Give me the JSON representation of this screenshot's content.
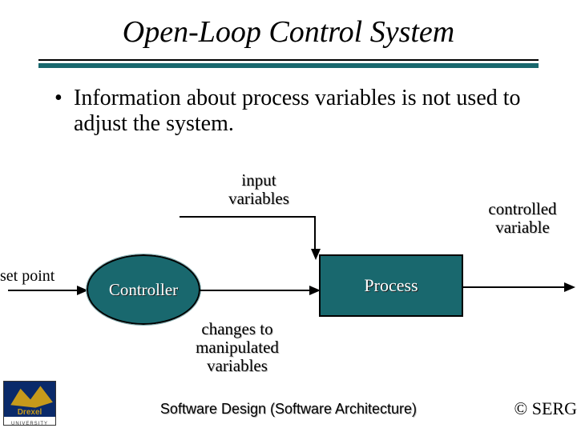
{
  "title": "Open-Loop Control System",
  "bullet": "Information about process variables is not used to adjust the system.",
  "diagram": {
    "set_point": "set point",
    "controller": "Controller",
    "input_variables": "input\nvariables",
    "process": "Process",
    "changes_label": "changes to\nmanipulated\nvariables",
    "controlled_variable": "controlled\nvariable"
  },
  "footer": "Software Design (Software Architecture)",
  "copyright": "© SERG",
  "logo": {
    "brand": "Drexel",
    "uni": "UNIVERSITY"
  }
}
